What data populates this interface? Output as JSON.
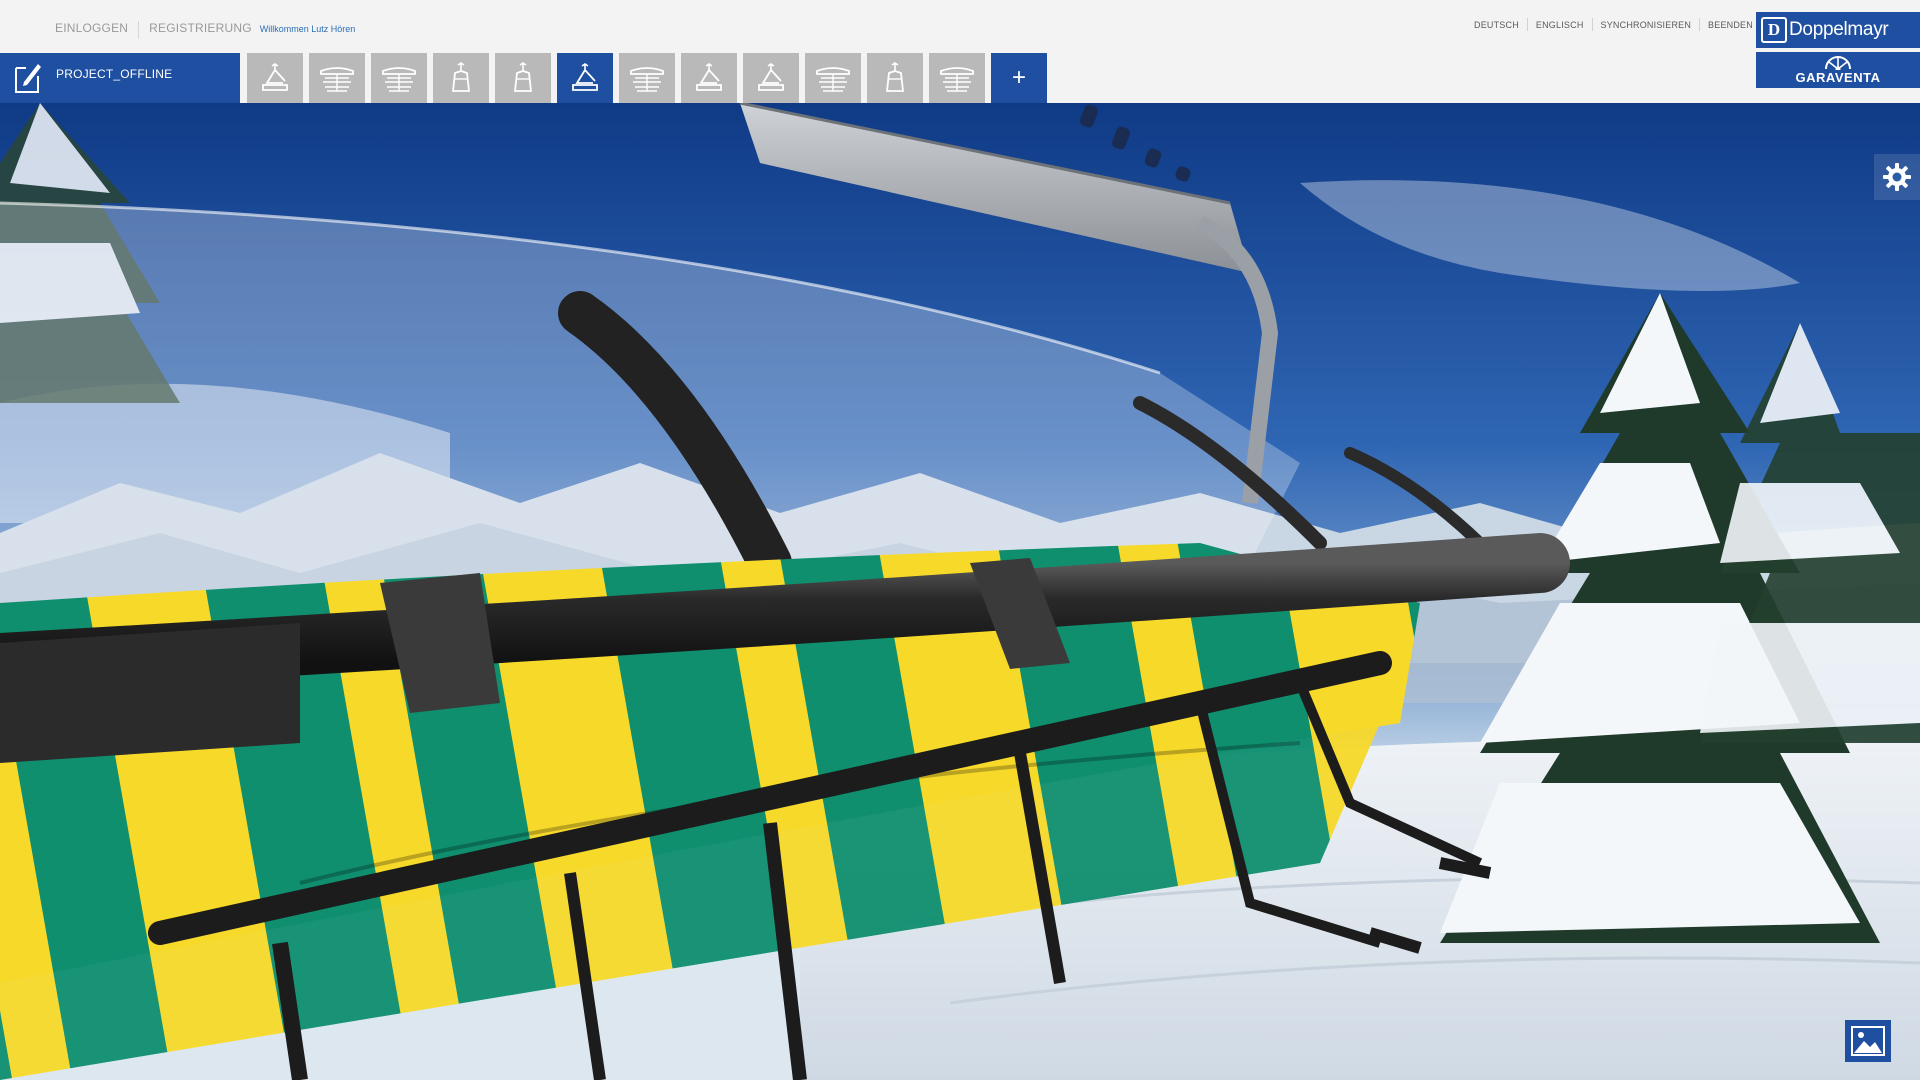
{
  "header": {
    "login_label": "EINLOGGEN",
    "register_label": "REGISTRIERUNG",
    "welcome_text": "Willkommen Lutz Hören",
    "nav": {
      "german": "DEUTSCH",
      "english": "ENGLISCH",
      "sync": "SYNCHRONISIEREN",
      "quit": "BEENDEN"
    },
    "logos": {
      "doppelmayr": "Doppelmayr",
      "doppelmayr_mark": "D",
      "garaventa": "GARAVENTA"
    }
  },
  "toolbar": {
    "project_name": "PROJECT_OFFLINE",
    "project_icon": "document-edit-icon",
    "add_label": "+",
    "variants": [
      {
        "icon": "chairlift-bench-icon",
        "active": false
      },
      {
        "icon": "chairlift-bubble-icon",
        "active": false
      },
      {
        "icon": "chairlift-bubble-icon",
        "active": false
      },
      {
        "icon": "gondola-cabin-icon",
        "active": false
      },
      {
        "icon": "gondola-cabin-icon",
        "active": false
      },
      {
        "icon": "chairlift-bench-icon",
        "active": true
      },
      {
        "icon": "chairlift-bubble-icon",
        "active": false
      },
      {
        "icon": "chairlift-bench-icon",
        "active": false
      },
      {
        "icon": "chairlift-bench-icon",
        "active": false
      },
      {
        "icon": "chairlift-bubble-icon",
        "active": false
      },
      {
        "icon": "gondola-cabin-icon",
        "active": false
      },
      {
        "icon": "chairlift-bubble-icon",
        "active": false
      }
    ]
  },
  "viewport": {
    "settings_icon": "gear-icon",
    "background_icon": "landscape-image-icon"
  },
  "colors": {
    "brand_blue": "#1f4fa0",
    "tile_gray": "#b9b9b9",
    "seat_yellow": "#f7d92a",
    "seat_green": "#0f8f6e"
  }
}
